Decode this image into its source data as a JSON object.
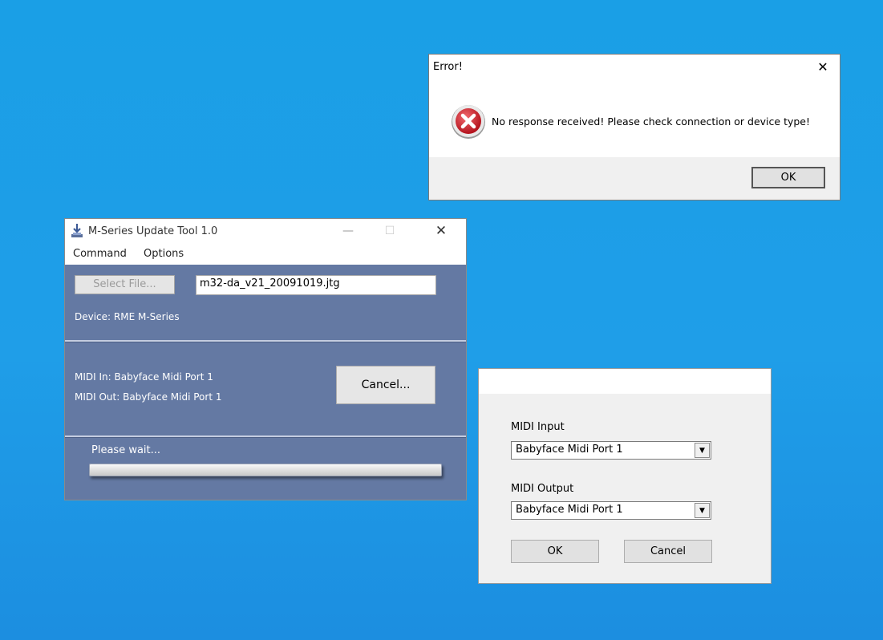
{
  "error_dialog": {
    "title": "Error!",
    "message": "No response received! Please check connection or device type!",
    "ok_label": "OK",
    "icon": "error-icon",
    "icon_color": "#c8202a"
  },
  "update_tool": {
    "title": "M-Series Update Tool 1.0",
    "menu": [
      "Command",
      "Options"
    ],
    "select_file_label": "Select File...",
    "file_name": "m32-da_v21_20091019.jtg",
    "device": "Device: RME M-Series",
    "midi_in": "MIDI In: Babyface Midi Port 1",
    "midi_out": "MIDI Out: Babyface Midi Port 1",
    "cancel_label": "Cancel...",
    "status": "Please wait...",
    "background_color": "#6479a3"
  },
  "midi_dialog": {
    "input_label": "MIDI Input",
    "input_value": "Babyface Midi Port 1",
    "output_label": "MIDI Output",
    "output_value": "Babyface Midi Port 1",
    "ok_label": "OK",
    "cancel_label": "Cancel"
  }
}
